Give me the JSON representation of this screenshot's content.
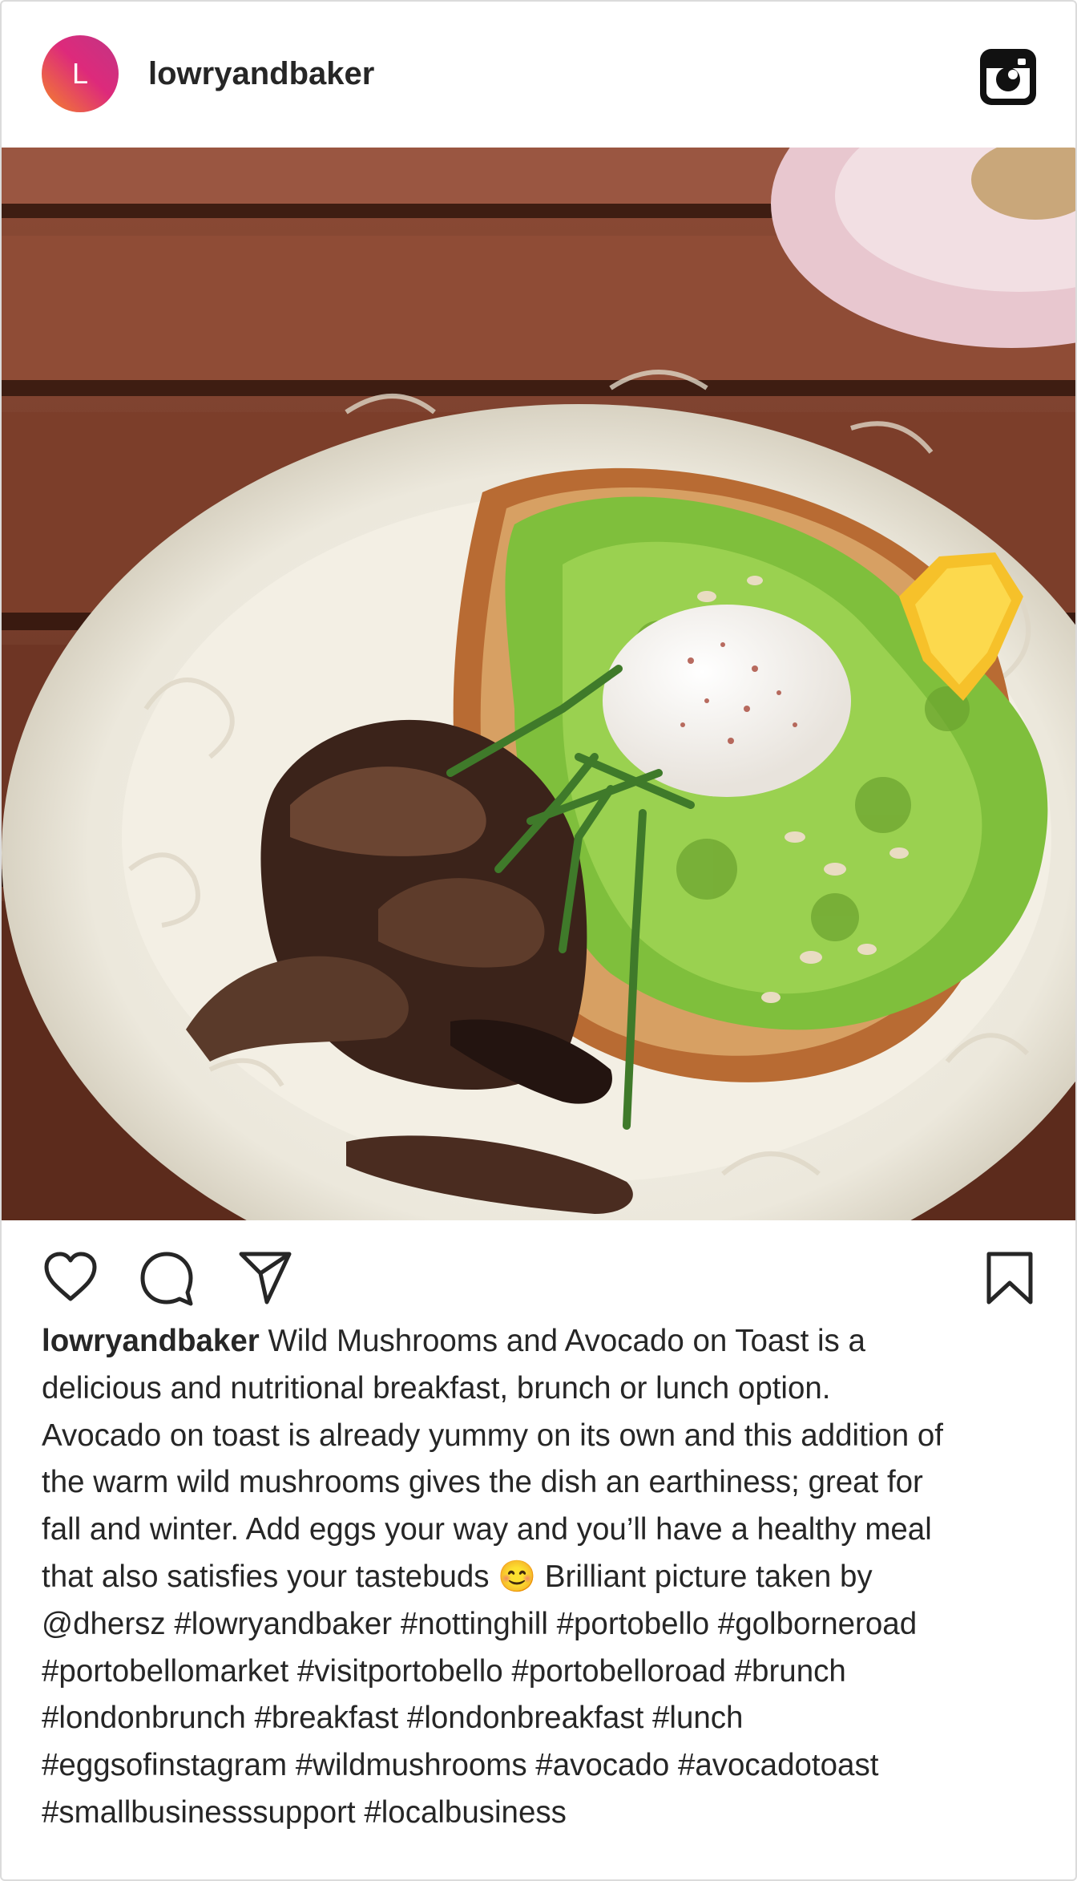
{
  "post": {
    "avatar_letter": "L",
    "username": "lowryandbaker"
  },
  "icons": {
    "logo": "instagram-icon",
    "like": "heart-icon",
    "comment": "comment-icon",
    "share": "send-icon",
    "save": "bookmark-icon"
  },
  "colors": {
    "avatar_gradient_start": "#f58529",
    "avatar_gradient_end": "#c13584",
    "text": "#262626",
    "border": "#dbdbdb"
  },
  "caption": {
    "username": "lowryandbaker",
    "lines": [
      "Wild Mushrooms and Avocado on Toast is a",
      "delicious and nutritional breakfast, brunch or lunch option.",
      "Avocado on toast is already yummy on its own and this addition of",
      "the warm wild mushrooms gives the dish an earthiness; great for",
      "fall and winter. Add eggs your way and you’ll have a healthy meal",
      "that also satisfies your tastebuds 😊 Brilliant picture taken by",
      "@dhersz #lowryandbaker #nottinghill #portobello #golborneroad",
      "#portobellomarket #visitportobello #portobelloroad #brunch",
      "#londonbrunch #breakfast #londonbreakfast #lunch",
      "#eggsofinstagram #wildmushrooms #avocado #avocadotoast",
      "#smallbusinesssupport #localbusiness"
    ]
  }
}
